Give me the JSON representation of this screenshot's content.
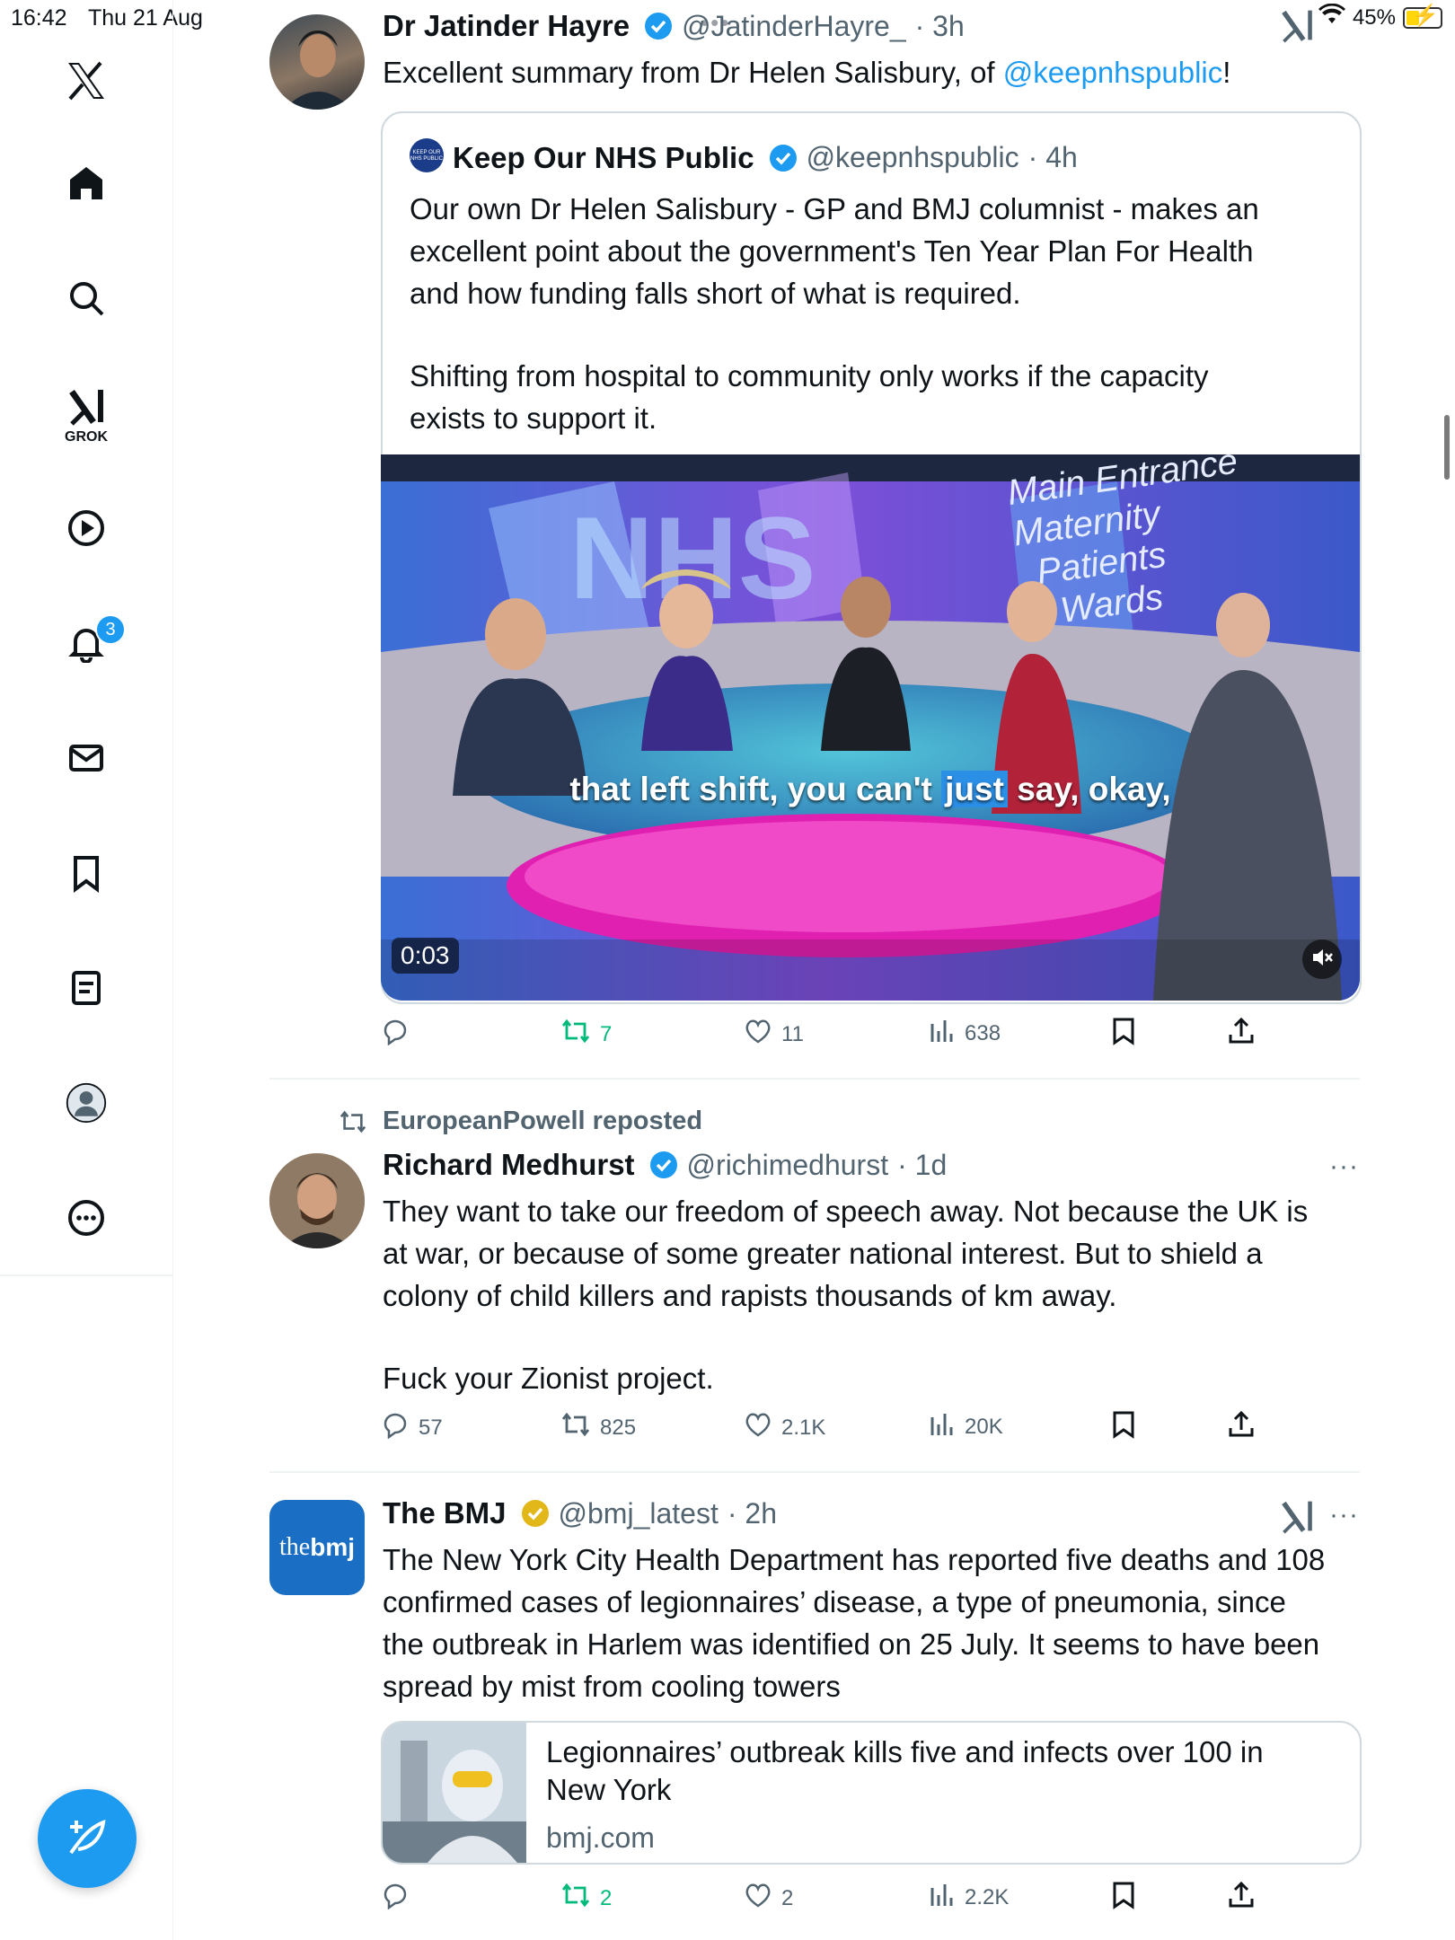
{
  "status_bar": {
    "time": "16:42",
    "date": "Thu 21 Aug",
    "battery": "45%"
  },
  "sidebar": {
    "items": [
      {
        "icon": "x-logo-icon"
      },
      {
        "icon": "home-icon"
      },
      {
        "icon": "search-icon"
      },
      {
        "icon": "grok-icon",
        "label": "GROK"
      },
      {
        "icon": "video-play-icon"
      },
      {
        "icon": "notifications-bell-icon",
        "badge": "3"
      },
      {
        "icon": "messages-envelope-icon"
      },
      {
        "icon": "bookmarks-icon"
      },
      {
        "icon": "lists-icon"
      },
      {
        "icon": "profile-icon"
      },
      {
        "icon": "more-circle-icon"
      }
    ],
    "compose_icon": "compose-feather-icon"
  },
  "tweets": [
    {
      "name": "Dr Jatinder Hayre",
      "handle": "@JatinderHayre_",
      "time": "· 3h",
      "text_prefix": "Excellent summary from Dr Helen Salisbury, of ",
      "mention": "@keepnhspublic",
      "text_suffix": "!",
      "quote": {
        "name": "Keep Our NHS Public",
        "handle": "@keepnhspublic",
        "time": "· 4h",
        "lines": [
          "Our own Dr Helen Salisbury - GP and BMJ columnist - makes an",
          "excellent point about the government's Ten Year Plan For Health",
          "and how funding falls short of what is required.",
          "",
          "Shifting from hospital to community only works if the capacity",
          "exists to support it."
        ],
        "video": {
          "caption_before": "that left shift, you can't ",
          "caption_highlight": "just",
          "caption_after": " say, okay,",
          "duration": "0:03",
          "bg_text_1": "NHS",
          "sign_lines": [
            "Main Entrance",
            "Maternity",
            "Patients",
            "Wards"
          ]
        }
      },
      "stats": {
        "replies": "",
        "reposts": "7",
        "likes": "11",
        "views": "638"
      }
    },
    {
      "repost_by": "EuropeanPowell reposted",
      "name": "Richard Medhurst",
      "handle": "@richimedhurst",
      "time": "· 1d",
      "lines": [
        "They want to take our freedom of speech away. Not because the UK is",
        "at war, or because of some greater national interest. But to shield a",
        "colony of child killers and rapists thousands of km away.",
        "",
        "Fuck your Zionist project."
      ],
      "stats": {
        "replies": "57",
        "reposts": "825",
        "likes": "2.1K",
        "views": "20K"
      }
    },
    {
      "name": "The BMJ",
      "handle": "@bmj_latest",
      "time": "· 2h",
      "avatar_text_1": "the",
      "avatar_text_2": "bmj",
      "lines": [
        "The New York City Health Department has reported five deaths and 108",
        "confirmed cases of legionnaires’ disease, a type of pneumonia, since",
        "the outbreak in Harlem was identified on 25 July. It seems to have been",
        "spread by mist from cooling towers"
      ],
      "link_card": {
        "title_line_1": "Legionnaires’ outbreak kills five and infects over 100 in",
        "title_line_2": "New York",
        "domain": "bmj.com"
      },
      "stats": {
        "replies": "",
        "reposts": "2",
        "likes": "2",
        "views": "2.2K"
      }
    }
  ],
  "colors": {
    "accent": "#1d9bf0",
    "repost_green": "#00ba7c",
    "gold_check": "#e2b719",
    "muted": "#536471"
  }
}
